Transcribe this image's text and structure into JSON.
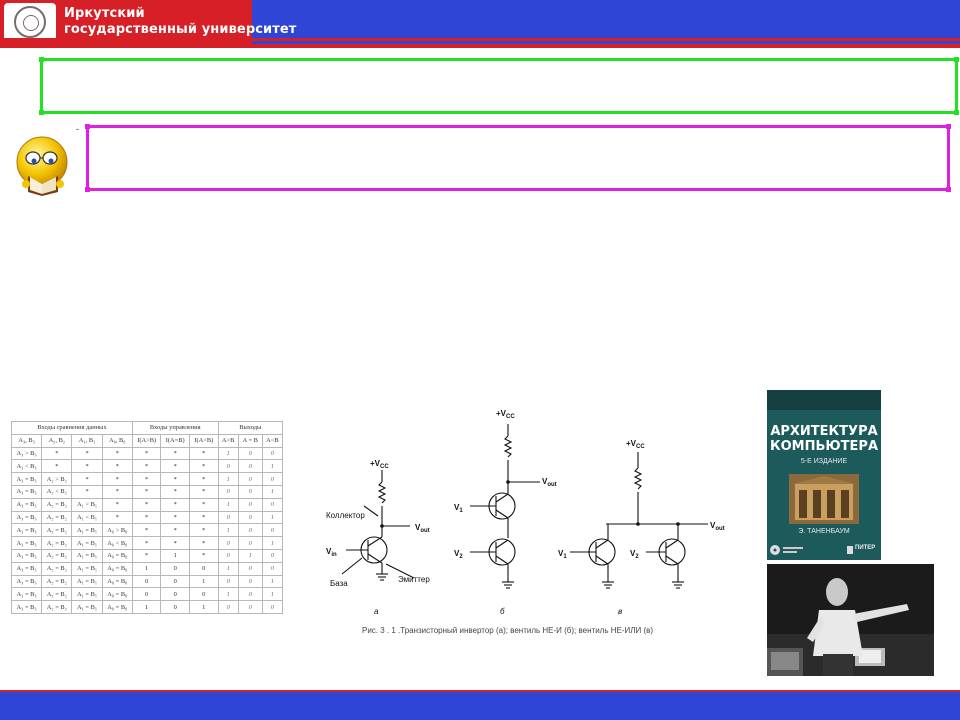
{
  "header": {
    "university_line1": "Иркутский",
    "university_line2": "государственный университет",
    "colors": {
      "bar": "#2f45d6",
      "logo_block": "#d61f26",
      "accent_line": "#d61f26"
    }
  },
  "placeholders": {
    "title_box_color": "#22e022",
    "subtitle_box_color": "#e020e0",
    "subtitle_bullet": "-"
  },
  "comparator_table": {
    "group_headers": [
      "Входы сравнения данных",
      "Входы управления",
      "Выходы"
    ],
    "columns": [
      "A₃, B₃",
      "A₂, B₂",
      "A₁, B₁",
      "A₀, B₀",
      "I(A>B)",
      "I(A=B)",
      "I(A<B)",
      "A>B",
      "A = B",
      "A<B"
    ],
    "rows": [
      [
        "A₃ > B₃",
        "*",
        "*",
        "*",
        "*",
        "*",
        "*",
        "1",
        "0",
        "0"
      ],
      [
        "A₃ < B₃",
        "*",
        "*",
        "*",
        "*",
        "*",
        "*",
        "0",
        "0",
        "1"
      ],
      [
        "A₃ = B₃",
        "A₂ > B₂",
        "*",
        "*",
        "*",
        "*",
        "*",
        "1",
        "0",
        "0"
      ],
      [
        "A₃ = B₃",
        "A₂ < B₂",
        "*",
        "*",
        "*",
        "*",
        "*",
        "0",
        "0",
        "1"
      ],
      [
        "A₃ = B₃",
        "A₂ = B₂",
        "A₁ > B₁",
        "*",
        "*",
        "*",
        "*",
        "1",
        "0",
        "0"
      ],
      [
        "A₃ = B₃",
        "A₂ = B₂",
        "A₁ < B₁",
        "*",
        "*",
        "*",
        "*",
        "0",
        "0",
        "1"
      ],
      [
        "A₃ = B₃",
        "A₂ = B₂",
        "A₁ = B₁",
        "A₀ > B₀",
        "*",
        "*",
        "*",
        "1",
        "0",
        "0"
      ],
      [
        "A₃ = B₃",
        "A₂ = B₂",
        "A₁ = B₁",
        "A₀ < B₀",
        "*",
        "*",
        "*",
        "0",
        "0",
        "1"
      ],
      [
        "A₃ = B₃",
        "A₂ = B₂",
        "A₁ = B₁",
        "A₀ = B₀",
        "*",
        "1",
        "*",
        "0",
        "1",
        "0"
      ],
      [
        "A₃ = B₃",
        "A₂ = B₂",
        "A₁ = B₁",
        "A₀ = B₀",
        "1",
        "0",
        "0",
        "1",
        "0",
        "0"
      ],
      [
        "A₃ = B₃",
        "A₂ = B₂",
        "A₁ = B₁",
        "A₀ = B₀",
        "0",
        "0",
        "1",
        "0",
        "0",
        "1"
      ],
      [
        "A₃ = B₃",
        "A₂ = B₂",
        "A₁ = B₁",
        "A₀ = B₀",
        "0",
        "0",
        "0",
        "1",
        "0",
        "1"
      ],
      [
        "A₃ = B₃",
        "A₂ = B₂",
        "A₁ = B₁",
        "A₀ = B₀",
        "1",
        "0",
        "1",
        "0",
        "0",
        "0"
      ]
    ]
  },
  "circuits": {
    "vcc_a": "+V",
    "vcc_sub": "CC",
    "label_collector": "Коллектор",
    "label_base": "База",
    "label_emitter": "Эмиттер",
    "vout": "V",
    "vout_sub": "out",
    "vin": "V",
    "vin_sub": "in",
    "v1": "V",
    "v1_sub": "1",
    "v2": "V",
    "v2_sub": "2",
    "label_a": "а",
    "label_b": "б",
    "label_c": "в",
    "caption": "Рис. 3 . 1 .Транзисторный инвертор (а); вентиль НЕ-И (б); вентиль НЕ-ИЛИ (в)"
  },
  "book": {
    "title_line1": "АРХИТЕКТУРА",
    "title_line2": "КОМПЬЮТЕРА",
    "edition": "5-Е ИЗДАНИЕ",
    "author": "Э. ТАНЕНБАУМ",
    "publisher": "ПИТЕР",
    "cover_color": "#1c5a5c"
  },
  "footer": {
    "color": "#2f45d6"
  }
}
